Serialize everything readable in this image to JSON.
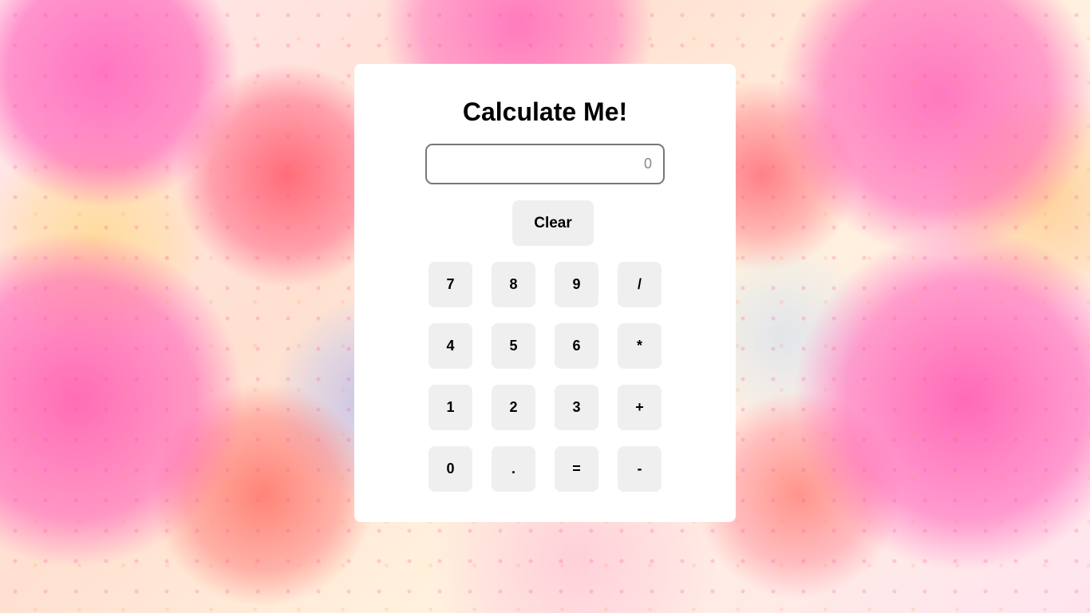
{
  "calculator": {
    "title": "Calculate Me!",
    "display": {
      "placeholder": "0",
      "value": ""
    },
    "clear_label": "Clear",
    "keys": [
      [
        "7",
        "8",
        "9",
        "/"
      ],
      [
        "4",
        "5",
        "6",
        "*"
      ],
      [
        "1",
        "2",
        "3",
        "+"
      ],
      [
        "0",
        ".",
        "=",
        "-"
      ]
    ]
  }
}
